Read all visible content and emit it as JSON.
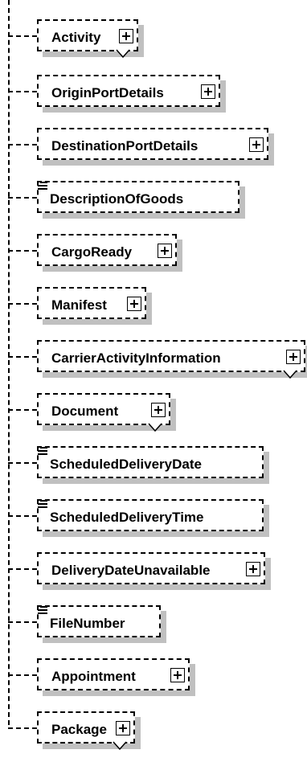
{
  "nodes": [
    {
      "label": "Activity",
      "expandable": true,
      "chevron": true,
      "simple": false
    },
    {
      "label": "OriginPortDetails",
      "expandable": true,
      "chevron": false,
      "simple": false
    },
    {
      "label": "DestinationPortDetails",
      "expandable": true,
      "chevron": false,
      "simple": false
    },
    {
      "label": "DescriptionOfGoods",
      "expandable": false,
      "chevron": false,
      "simple": true
    },
    {
      "label": "CargoReady",
      "expandable": true,
      "chevron": false,
      "simple": false
    },
    {
      "label": "Manifest",
      "expandable": true,
      "chevron": false,
      "simple": false
    },
    {
      "label": "CarrierActivityInformation",
      "expandable": true,
      "chevron": true,
      "simple": false
    },
    {
      "label": "Document",
      "expandable": true,
      "chevron": true,
      "simple": false
    },
    {
      "label": "ScheduledDeliveryDate",
      "expandable": false,
      "chevron": false,
      "simple": true
    },
    {
      "label": "ScheduledDeliveryTime",
      "expandable": false,
      "chevron": false,
      "simple": true
    },
    {
      "label": "DeliveryDateUnavailable",
      "expandable": true,
      "chevron": false,
      "simple": false
    },
    {
      "label": "FileNumber",
      "expandable": false,
      "chevron": false,
      "simple": true
    },
    {
      "label": "Appointment",
      "expandable": true,
      "chevron": false,
      "simple": false
    },
    {
      "label": "Package",
      "expandable": true,
      "chevron": true,
      "simple": false
    }
  ]
}
